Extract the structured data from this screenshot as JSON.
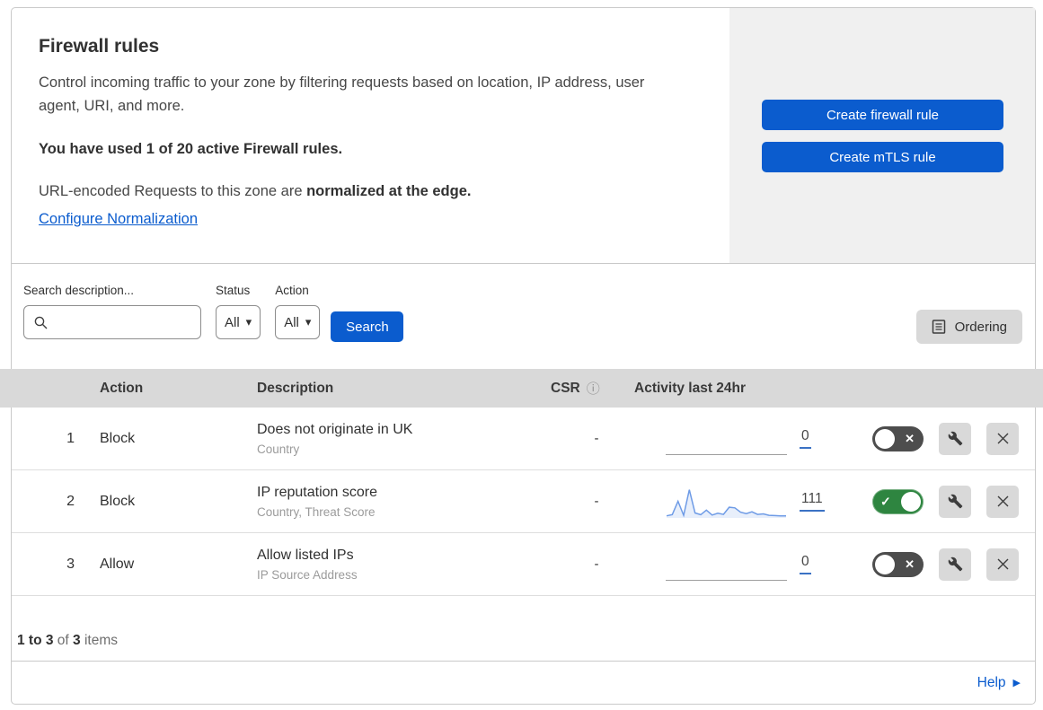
{
  "colors": {
    "primary": "#0b5cce",
    "panel_gray": "#f0f0f0",
    "band_gray": "#d9d9d9",
    "toggle_on": "#2e8540",
    "toggle_off": "#4d4d4d",
    "sparkline": "#6e9be6"
  },
  "header": {
    "title": "Firewall rules",
    "description": "Control incoming traffic to your zone by filtering requests based on location, IP address, user agent, URI, and more.",
    "usage": "You have used 1 of 20 active Firewall rules.",
    "normalization_prefix": "URL-encoded Requests to this zone are ",
    "normalization_bold": "normalized at the edge.",
    "normalization_link": "Configure Normalization",
    "buttons": [
      {
        "label": "Create firewall rule"
      },
      {
        "label": "Create mTLS rule"
      }
    ]
  },
  "filters": {
    "search_label": "Search description...",
    "search_value": "",
    "status_label": "Status",
    "status_value": "All",
    "action_label": "Action",
    "action_value": "All",
    "search_button": "Search",
    "ordering_button": "Ordering"
  },
  "table": {
    "headers": {
      "action": "Action",
      "description": "Description",
      "csr": "CSR",
      "activity": "Activity last 24hr"
    },
    "rows": [
      {
        "index": "1",
        "action": "Block",
        "description": "Does not originate in UK",
        "criteria": "Country",
        "csr": "-",
        "activity_count": "0",
        "enabled": false,
        "sparkline": null
      },
      {
        "index": "2",
        "action": "Block",
        "description": "IP reputation score",
        "criteria": "Country, Threat Score",
        "csr": "-",
        "activity_count": "111",
        "enabled": true,
        "sparkline": [
          4,
          8,
          55,
          6,
          95,
          14,
          8,
          24,
          7,
          13,
          9,
          34,
          32,
          17,
          12,
          18,
          9,
          11,
          6,
          5,
          4,
          4
        ]
      },
      {
        "index": "3",
        "action": "Allow",
        "description": "Allow listed IPs",
        "criteria": "IP Source Address",
        "csr": "-",
        "activity_count": "0",
        "enabled": false,
        "sparkline": null
      }
    ]
  },
  "footer": {
    "range": "1 to 3",
    "of_label": "of",
    "total": "3",
    "items_label": "items",
    "help": "Help"
  }
}
